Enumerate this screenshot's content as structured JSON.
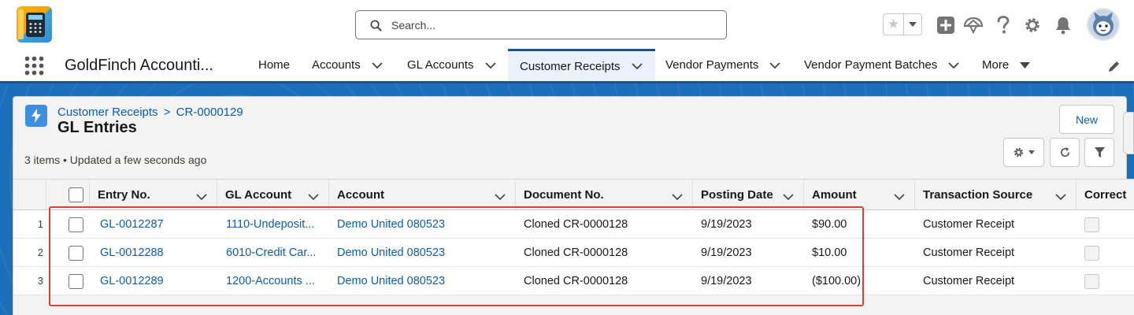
{
  "header": {
    "search_placeholder": "Search...",
    "app_logo": "goldfinch-calculator-logo",
    "icons": [
      "star-icon",
      "chevron-down-icon",
      "plus-icon",
      "trailhead-icon",
      "help-icon",
      "gear-icon",
      "bell-icon",
      "avatar"
    ]
  },
  "nav": {
    "app_name": "GoldFinch Accounti...",
    "items": [
      {
        "label": "Home",
        "has_menu": false
      },
      {
        "label": "Accounts",
        "has_menu": true
      },
      {
        "label": "GL Accounts",
        "has_menu": true
      },
      {
        "label": "Customer Receipts",
        "has_menu": true,
        "active": true
      },
      {
        "label": "Vendor Payments",
        "has_menu": true
      },
      {
        "label": "Vendor Payment Batches",
        "has_menu": true
      },
      {
        "label": "More",
        "has_menu": true
      }
    ]
  },
  "list_header": {
    "breadcrumb_parent": "Customer Receipts",
    "breadcrumb_separator": ">",
    "breadcrumb_record": "CR-0000129",
    "title": "GL Entries",
    "info": "3 items • Updated a few seconds ago",
    "new_label": "New"
  },
  "table": {
    "columns": [
      "Entry No.",
      "GL Account",
      "Account",
      "Document No.",
      "Posting Date",
      "Amount",
      "Transaction Source",
      "Correct"
    ],
    "rows": [
      {
        "num": "1",
        "entry": "GL-0012287",
        "gl_account": "1110-Undeposit...",
        "account": "Demo United 080523",
        "document": "Cloned CR-0000128",
        "date": "9/19/2023",
        "amount": "$90.00",
        "source": "Customer Receipt"
      },
      {
        "num": "2",
        "entry": "GL-0012288",
        "gl_account": "6010-Credit Car...",
        "account": "Demo United 080523",
        "document": "Cloned CR-0000128",
        "date": "9/19/2023",
        "amount": "$10.00",
        "source": "Customer Receipt"
      },
      {
        "num": "3",
        "entry": "GL-0012289",
        "gl_account": "1200-Accounts ...",
        "account": "Demo United 080523",
        "document": "Cloned CR-0000128",
        "date": "9/19/2023",
        "amount": "($100.00)",
        "source": "Customer Receipt"
      }
    ]
  },
  "colors": {
    "brand_blue": "#1b5297",
    "link_blue": "#0b5cab",
    "band_blue": "#1b6fba",
    "highlight_red": "#d9403a"
  }
}
